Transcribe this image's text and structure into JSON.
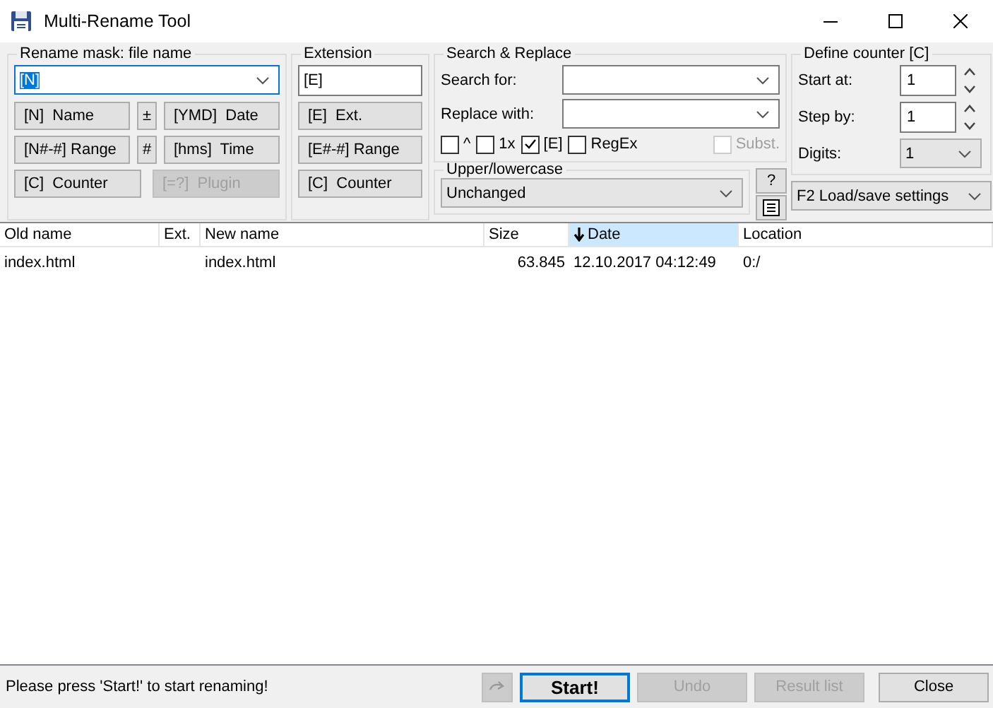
{
  "window": {
    "title": "Multi-Rename Tool"
  },
  "rename_mask": {
    "title": "Rename mask: file name",
    "value": "[N]",
    "text_selected": true,
    "buttons": [
      {
        "label": "[N]  Name",
        "kind": "wide",
        "disabled": false
      },
      {
        "label": "±",
        "kind": "narrow",
        "disabled": false
      },
      {
        "label": "[YMD]  Date",
        "kind": "wide",
        "disabled": false
      },
      {
        "label": "[N#-#] Range",
        "kind": "wide",
        "disabled": false
      },
      {
        "label": "#",
        "kind": "narrow",
        "disabled": false
      },
      {
        "label": "[hms]  Time",
        "kind": "wide",
        "disabled": false
      },
      {
        "label": "[C]  Counter",
        "kind": "half",
        "disabled": false
      },
      {
        "label": "[=?]  Plugin",
        "kind": "half",
        "disabled": true
      }
    ]
  },
  "extension": {
    "title": "Extension",
    "value": "[E]",
    "buttons": [
      {
        "label": "[E]  Ext.",
        "disabled": false
      },
      {
        "label": "[E#-#] Range",
        "disabled": false
      },
      {
        "label": "[C]  Counter",
        "disabled": false
      }
    ]
  },
  "search_replace": {
    "title": "Search & Replace",
    "fields": [
      {
        "label": "Search for:"
      },
      {
        "label": "Replace with:"
      }
    ],
    "options": [
      {
        "label": "^",
        "checked": false,
        "disabled": false
      },
      {
        "label": "1x",
        "checked": false,
        "disabled": false
      },
      {
        "label": "[E]",
        "checked": true,
        "disabled": false
      },
      {
        "label": "RegEx",
        "checked": false,
        "disabled": false
      },
      {
        "label": "Subst.",
        "checked": false,
        "disabled": true
      }
    ]
  },
  "case": {
    "title": "Upper/lowercase",
    "value": "Unchanged",
    "help_button": "?"
  },
  "counter": {
    "title": "Define counter [C]",
    "start_at": {
      "label": "Start at:",
      "value": "1"
    },
    "step_by": {
      "label": "Step by:",
      "value": "1"
    },
    "digits": {
      "label": "Digits:",
      "value": "1"
    }
  },
  "settings": {
    "value": "F2 Load/save settings"
  },
  "file_list": {
    "columns": [
      {
        "label": "Old name",
        "sorted": false
      },
      {
        "label": "Ext.",
        "sorted": false
      },
      {
        "label": "New name",
        "sorted": false
      },
      {
        "label": "Size",
        "sorted": false
      },
      {
        "label": "Date",
        "sorted": true
      },
      {
        "label": "Location",
        "sorted": false
      }
    ],
    "rows": [
      {
        "old_name": "index.html",
        "new_name": "index.html",
        "size": "63.845",
        "date": "12.10.2017 04:12:49",
        "location": "0:/"
      }
    ]
  },
  "status_bar": {
    "message": "Please press 'Start!' to start renaming!",
    "buttons": [
      {
        "kind": "icon",
        "disabled": true
      },
      {
        "label": "Start!",
        "kind": "default",
        "disabled": false
      },
      {
        "label": "Undo",
        "kind": "text",
        "disabled": true
      },
      {
        "label": "Result list",
        "kind": "text",
        "disabled": true
      },
      {
        "label": "Close",
        "kind": "text",
        "disabled": false
      }
    ]
  }
}
